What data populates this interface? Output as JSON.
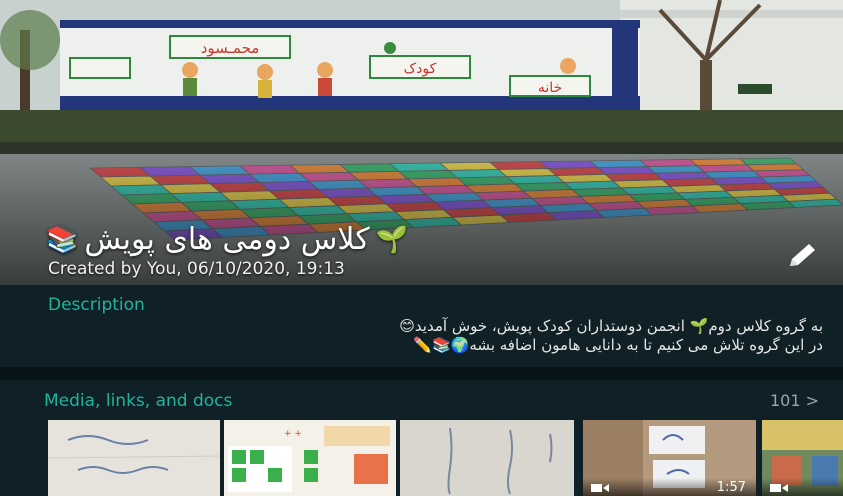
{
  "header": {
    "group_name": "کلاس دومی های پویش",
    "title_emoji_left": "📚",
    "title_emoji_right": "🌱",
    "created_text": "Created by You, 06/10/2020, 19:13",
    "edit_icon": "pencil-icon"
  },
  "description": {
    "label": "Description",
    "line1": "به گروه کلاس دوم🌱 انجمن دوستداران کودک پویش، خوش آمدید😊",
    "line2": "در این گروه تلاش می کنیم تا به دانایی هامون اضافه بشه🌍📚✏️"
  },
  "media": {
    "label": "Media, links, and docs",
    "count": "101 >",
    "items": [
      {
        "type": "image"
      },
      {
        "type": "image"
      },
      {
        "type": "image"
      },
      {
        "type": "video",
        "duration": "1:57"
      },
      {
        "type": "video"
      }
    ]
  },
  "colors": {
    "accent": "#1fb59c",
    "panel": "#0f2026",
    "divider": "#091419"
  }
}
